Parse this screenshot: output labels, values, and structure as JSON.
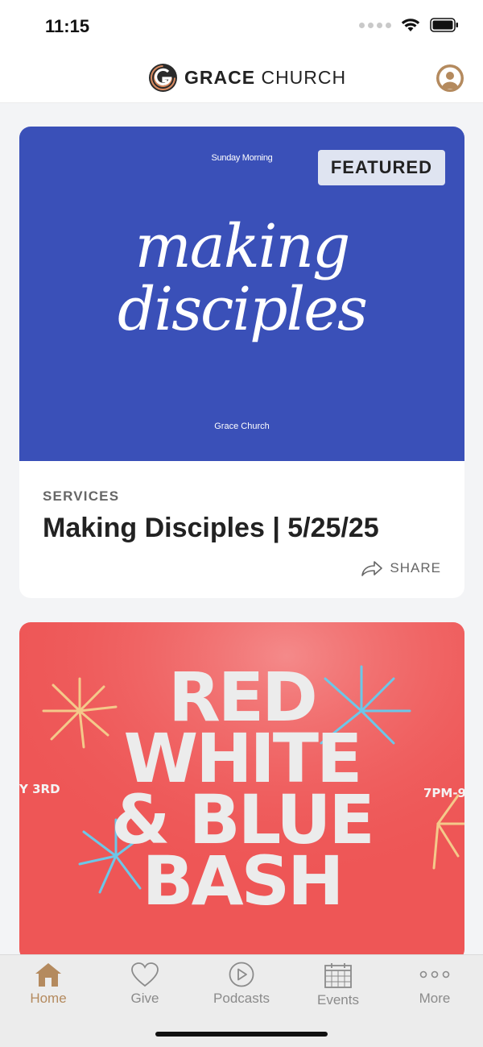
{
  "status_bar": {
    "time": "11:15"
  },
  "header": {
    "brand_bold": "GRACE",
    "brand_light": "CHURCH"
  },
  "cards": [
    {
      "hero": {
        "kicker": "Sunday Morning",
        "badge": "FEATURED",
        "title_line1": "making",
        "title_line2": "disciples",
        "footer": "Grace Church",
        "bg_color": "#3a50b8"
      },
      "category": "SERVICES",
      "title": "Making Disciples | 5/25/25",
      "share_label": "SHARE"
    },
    {
      "hero": {
        "title_lines": [
          "RED",
          "WHITE",
          "& BLUE",
          "BASH"
        ],
        "side_left": "Y 3RD",
        "side_right": "7PM-9",
        "bg_color": "#ee5656"
      }
    }
  ],
  "tabs": [
    {
      "label": "Home",
      "icon": "home-icon",
      "active": true
    },
    {
      "label": "Give",
      "icon": "heart-icon",
      "active": false
    },
    {
      "label": "Podcasts",
      "icon": "play-circle-icon",
      "active": false
    },
    {
      "label": "Events",
      "icon": "calendar-icon",
      "active": false
    },
    {
      "label": "More",
      "icon": "more-dots-icon",
      "active": false
    }
  ],
  "colors": {
    "accent": "#b48a5e",
    "inactive": "#8b8b8b"
  }
}
